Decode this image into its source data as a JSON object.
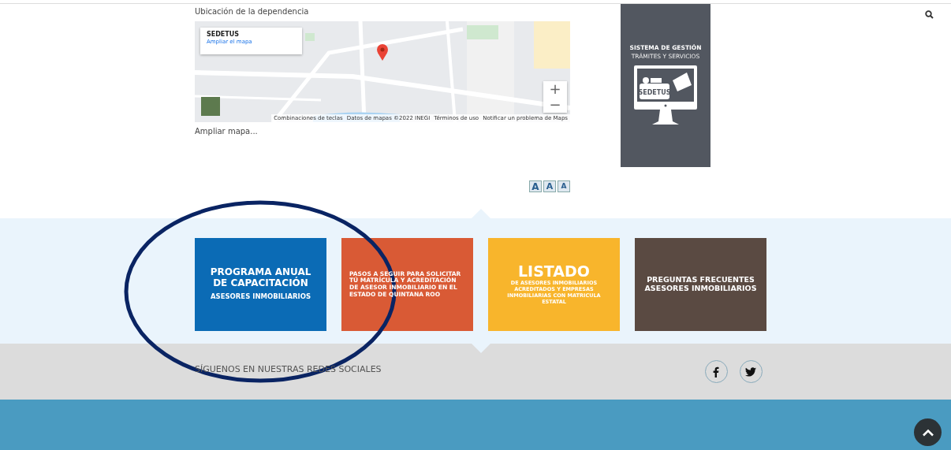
{
  "location": {
    "title": "Ubicación de la dependencia",
    "map": {
      "kind": "picture",
      "info_card": {
        "name": "SEDETUS",
        "link": "Ampliar el mapa"
      },
      "zoom_in": "+",
      "zoom_out": "−",
      "attribution": [
        "Combinaciones de teclas",
        "Datos de mapas ©2022 INEGI",
        "Términos de uso",
        "Notificar un problema de Maps"
      ]
    },
    "expand_link": "Ampliar mapa..."
  },
  "promo_panel": {
    "title": "SISTEMA DE GESTIÓN",
    "subtitle": "TRÁMITES Y SERVICIOS",
    "screen_label": "SEDETUS"
  },
  "font_size_buttons": [
    "A",
    "A",
    "A"
  ],
  "tiles": [
    {
      "kind": "program",
      "color": "#0b6bb5",
      "title": "PROGRAMA ANUAL DE  CAPACITACIÓN",
      "subtitle": "ASESORES INMOBILIARIOS"
    },
    {
      "kind": "steps",
      "color": "#d95a35",
      "title": "PASOS A SEGUIR PARA SOLICITAR TÚ MATRÍCULA Y ACREDITACIÓN DE ASESOR INMOBILIARIO EN EL ESTADO DE QUINTANA ROO"
    },
    {
      "kind": "list",
      "color": "#f8b52c",
      "title": "LISTADO",
      "subtitle": "DE ASESORES INMOBILIARIOS ACREDITADOS Y EMPRESAS INMOBILIARIAS CON MATRICULA ESTATAL"
    },
    {
      "kind": "faq",
      "color": "#5a4a42",
      "title": "PREGUNTAS FRECUENTES ASESORES INMOBILIARIOS"
    }
  ],
  "social": {
    "label": "SÍGUENOS EN NUESTRAS REDES SOCIALES"
  }
}
